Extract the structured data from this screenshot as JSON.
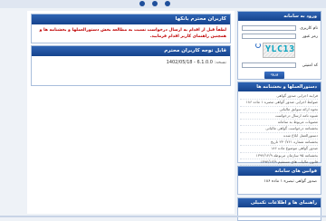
{
  "header": {
    "dots": 3
  },
  "main": {
    "welcome_title": "کاربران محترم بانکها",
    "welcome_text": "لطفاً قبل از اقدام به ارسال درخواست نسبت به مطالعه بخش دستورالعملها و بخشنامه ها و همچنین راهنمای کاربر اقدام فرمایید.",
    "version_title": "قابل توجه کاربران محترم",
    "version_label": "نسخه:",
    "version_value": "6.1.0.0 - 1402/05/18"
  },
  "login": {
    "title": "ورود به سامانه",
    "username_label": "نام کاربری",
    "password_label": "رمز عبور",
    "captcha_text": "YLC13",
    "captcha_label": "کد امنیتی",
    "submit_label": "ورود"
  },
  "regulations": {
    "title": "دستورالعملها و بخشنامه ها",
    "items": [
      "فرایند اجرایی صدور گواهی",
      "ضوابط اجرایی صدور گواهی تبصره ۱ ماده ۱۸۶",
      "نحوه ارائه سوابق مالیاتی",
      "شیوه نامه ارسال درخواست",
      "مصوبات مربوط به سامانه",
      "بخشنامه درخواست گواهی مالیاتی",
      "دستورالعمل ابلاغ شده",
      "بخشنامه شماره ۲۳۰/۷۶۱ تاریخ",
      "صدور گواهی موضوع ماده ۱۸۶",
      "بخشنامه ۹۵ سازمان مربوطه ۱۳۹۴/۱۲/۹",
      "قانون مالیات های مستقیم ۱۳۹۴/۱۲/۹"
    ]
  },
  "laws": {
    "title": "قوانین های سامانه",
    "item": "صدور گواهی تبصره ۱ ماده ۱۸۶"
  },
  "guides": {
    "title": "راهنمای ها و اطلاعات تکمیلی"
  }
}
